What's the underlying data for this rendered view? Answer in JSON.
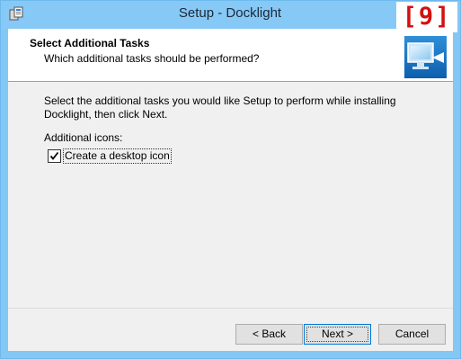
{
  "window": {
    "title": "Setup - Docklight",
    "logo_text": "[9]"
  },
  "header": {
    "title": "Select Additional Tasks",
    "subtitle": "Which additional tasks should be performed?",
    "image_icon": "monitor-arrow-icon"
  },
  "body": {
    "description": "Select the additional tasks you would like Setup to perform while installing Docklight, then click Next.",
    "section_label": "Additional icons:",
    "tasks": [
      {
        "label": "Create a desktop icon",
        "checked": true
      }
    ]
  },
  "buttons": {
    "back": "< Back",
    "next": "Next >",
    "cancel": "Cancel"
  },
  "colors": {
    "titlebar": "#86c9f6",
    "logo": "#d31010",
    "panel": "#f0f0f0",
    "focus": "#0078d7"
  }
}
